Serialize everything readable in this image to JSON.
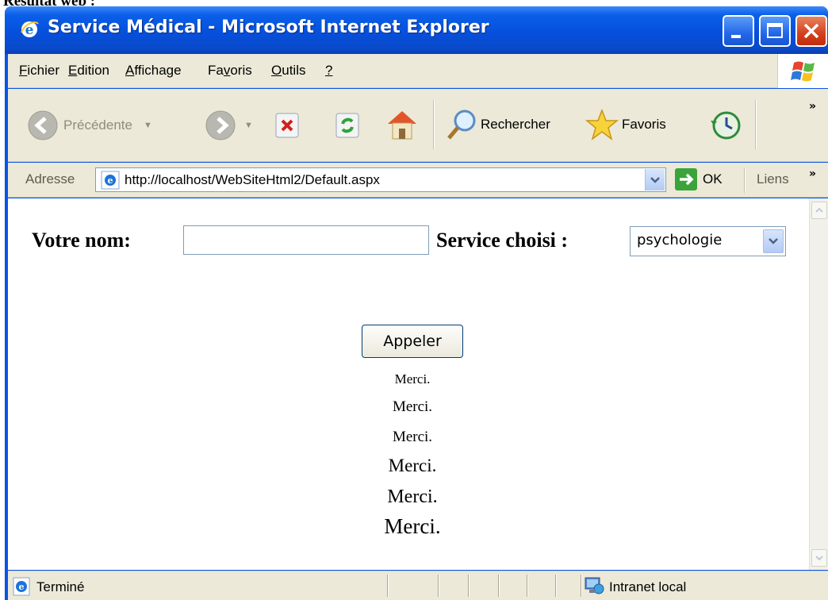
{
  "document": {
    "heading": "Résultat web :"
  },
  "window": {
    "title": "Service Médical - Microsoft Internet Explorer"
  },
  "menu": {
    "items": [
      {
        "label": "Fichier",
        "u": "F",
        "rest": "ichier"
      },
      {
        "label": "Edition",
        "u": "E",
        "rest": "dition"
      },
      {
        "label": "Affichage",
        "u": "A",
        "rest": "ffichage"
      },
      {
        "label": "Favoris",
        "pre": "Fa",
        "u": "v",
        "rest": "oris"
      },
      {
        "label": "Outils",
        "u": "O",
        "rest": "utils"
      },
      {
        "label": "?",
        "u": "?",
        "rest": ""
      }
    ]
  },
  "toolbar": {
    "back_label": "Précédente",
    "search_label": "Rechercher",
    "favorites_label": "Favoris",
    "more": "»"
  },
  "address": {
    "label": "Adresse",
    "url": "http://localhost/WebSiteHtml2/Default.aspx",
    "go_label": "OK",
    "links_label": "Liens",
    "more": "»"
  },
  "form": {
    "name_label": "Votre nom:",
    "name_value": "",
    "service_label": "Service choisi :",
    "service_selected": "psychologie",
    "button_label": "Appeler"
  },
  "messages": [
    "Merci.",
    "Merci.",
    "Merci.",
    "Merci.",
    "Merci.",
    "Merci."
  ],
  "status": {
    "text": "Terminé",
    "zone": "Intranet local"
  },
  "colors": {
    "titlebar": "#0550dc",
    "chrome": "#ece9d8",
    "close": "#d2401d"
  }
}
